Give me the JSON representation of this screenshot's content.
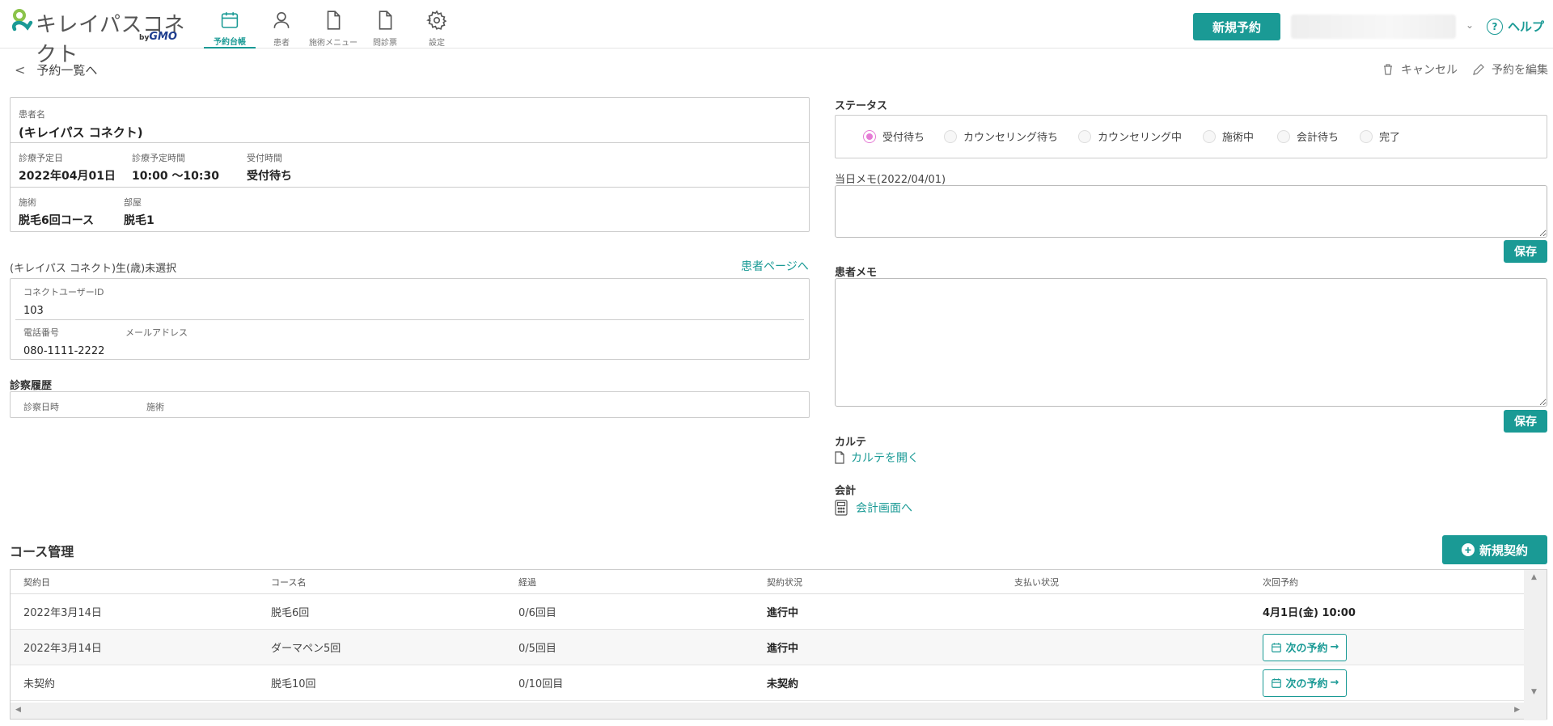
{
  "header": {
    "brand": "キレイパスコネクト",
    "brand_by": "by",
    "brand_company": "GMO",
    "nav": [
      {
        "label": "予約台帳",
        "icon": "calendar-icon",
        "active": true
      },
      {
        "label": "患者",
        "icon": "person-icon",
        "active": false
      },
      {
        "label": "施術メニュー",
        "icon": "document-icon",
        "active": false
      },
      {
        "label": "問診票",
        "icon": "document-icon",
        "active": false
      },
      {
        "label": "設定",
        "icon": "gear-icon",
        "active": false
      }
    ],
    "new_reservation": "新規予約",
    "help": "ヘルプ"
  },
  "subbar": {
    "back": "予約一覧へ",
    "cancel": "キャンセル",
    "edit": "予約を編集"
  },
  "reservation": {
    "patient_name_label": "患者名",
    "patient_name": "(キレイパス コネクト)",
    "date_label": "診療予定日",
    "date": "2022年04月01日",
    "time_label": "診療予定時間",
    "time": "10:00 〜10:30",
    "reception_label": "受付時間",
    "reception": "受付待ち",
    "treatment_label": "施術",
    "treatment": "脱毛6回コース",
    "room_label": "部屋",
    "room": "脱毛1"
  },
  "patient": {
    "heading": "(キレイパス コネクト)生(歳)未選択",
    "page_link": "患者ページへ",
    "connect_id_label": "コネクトユーザーID",
    "connect_id": "103",
    "phone_label": "電話番号",
    "phone": "080-1111-2222",
    "email_label": "メールアドレス",
    "email": ""
  },
  "history": {
    "title": "診察履歴",
    "col_date": "診察日時",
    "col_treatment": "施術"
  },
  "status": {
    "title": "ステータス",
    "options": [
      "受付待ち",
      "カウンセリング待ち",
      "カウンセリング中",
      "施術中",
      "会計待ち",
      "完了"
    ],
    "selected": "受付待ち"
  },
  "day_memo": {
    "label": "当日メモ(2022/04/01)",
    "save": "保存"
  },
  "patient_memo": {
    "label": "患者メモ",
    "save": "保存"
  },
  "chart": {
    "label": "カルテ",
    "link": "カルテを開く"
  },
  "billing": {
    "label": "会計",
    "link": "会計画面へ"
  },
  "course": {
    "title": "コース管理",
    "new_contract": "新規契約",
    "columns": [
      "契約日",
      "コース名",
      "経過",
      "契約状況",
      "支払い状況",
      "次回予約"
    ],
    "rows": [
      {
        "date": "2022年3月14日",
        "name": "脱毛6回",
        "progress": "0/6回目",
        "status": "進行中",
        "payment": "",
        "next": "4月1日(金) 10:00",
        "next_button": false
      },
      {
        "date": "2022年3月14日",
        "name": "ダーマペン5回",
        "progress": "0/5回目",
        "status": "進行中",
        "payment": "",
        "next": "次の予約",
        "next_button": true
      },
      {
        "date": "未契約",
        "name": "脱毛10回",
        "progress": "0/10回目",
        "status": "未契約",
        "payment": "",
        "next": "次の予約",
        "next_button": true
      }
    ]
  },
  "colors": {
    "accent": "#1a9a95",
    "radio_selected": "#e57bd5",
    "brand_blue": "#1f3e8f"
  }
}
